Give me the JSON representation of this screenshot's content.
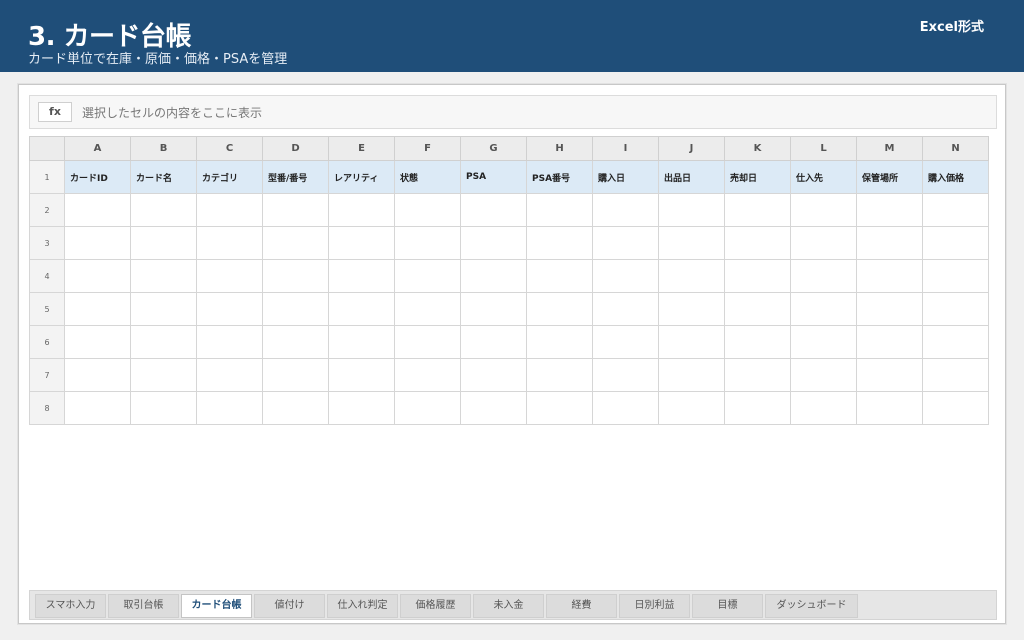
{
  "header": {
    "title": "3. カード台帳",
    "subtitle": "カード単位で在庫・原価・価格・PSAを管理",
    "format_label": "Excel形式"
  },
  "formula_bar": {
    "fx_label": "fx",
    "text": "選択したセルの内容をここに表示"
  },
  "grid": {
    "columns": [
      "A",
      "B",
      "C",
      "D",
      "E",
      "F",
      "G",
      "H",
      "I",
      "J",
      "K",
      "L",
      "M",
      "N"
    ],
    "rows": [
      "1",
      "2",
      "3",
      "4",
      "5",
      "6",
      "7",
      "8"
    ],
    "headers": [
      "カードID",
      "カード名",
      "カテゴリ",
      "型番/番号",
      "レアリティ",
      "状態",
      "PSA",
      "PSA番号",
      "購入日",
      "出品日",
      "売却日",
      "仕入先",
      "保管場所",
      "購入価格"
    ]
  },
  "tabs": [
    {
      "label": "スマホ入力",
      "active": false
    },
    {
      "label": "取引台帳",
      "active": false
    },
    {
      "label": "カード台帳",
      "active": true
    },
    {
      "label": "値付け",
      "active": false
    },
    {
      "label": "仕入れ判定",
      "active": false
    },
    {
      "label": "価格履歴",
      "active": false
    },
    {
      "label": "未入金",
      "active": false
    },
    {
      "label": "経費",
      "active": false
    },
    {
      "label": "日別利益",
      "active": false
    },
    {
      "label": "目標",
      "active": false
    },
    {
      "label": "ダッシュボード",
      "active": false
    }
  ],
  "colors": {
    "brand": "#1f4e79",
    "header_row": "#dceaf6"
  }
}
